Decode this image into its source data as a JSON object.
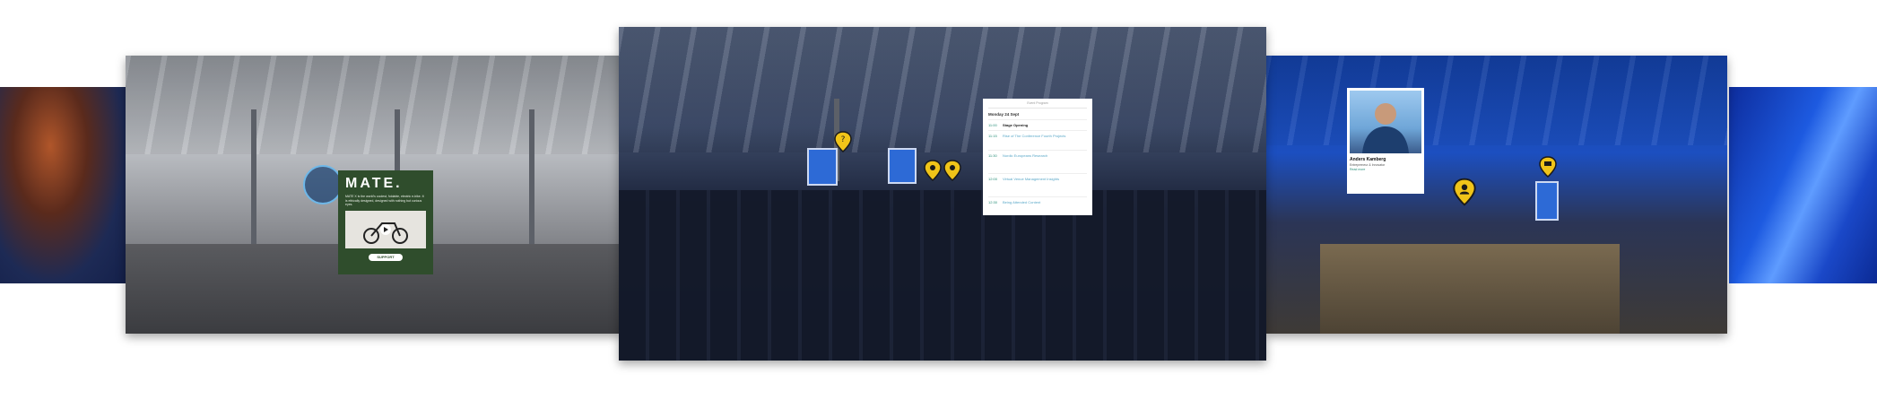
{
  "mate_card": {
    "title": "MATE.",
    "body": "MATE X is the world's coolest, foldable, electric e-bike. It is ethically designed, designed with nothing but curious eyes.",
    "button_label": "SUPPORT"
  },
  "schedule_card": {
    "header": "Event Program",
    "day": "Monday 24 Sept",
    "sessions": [
      {
        "time": "11:00",
        "title": "Stage Opening"
      },
      {
        "time": "11:15",
        "title": "Rise of The Conference Fourth Projects"
      },
      {
        "time": "11:30",
        "title": "Nordic Europeans Research"
      },
      {
        "time": "12:00",
        "title": "Virtual Venue Management Insights"
      },
      {
        "time": "12:30",
        "title": "Being Attended Content"
      }
    ]
  },
  "speaker_card": {
    "name": "Anders Kamberg",
    "role": "Entrepreneur & Innovator",
    "link": "Read more"
  },
  "colors": {
    "pin_fill": "#f0c419",
    "pin_stroke": "#1a1a1a",
    "mate_green": "#2f4d2c",
    "accent_teal": "#2a8f7a"
  },
  "icons": {
    "pin": "map-pin-icon",
    "play": "play-icon",
    "info": "info-ring-icon"
  }
}
